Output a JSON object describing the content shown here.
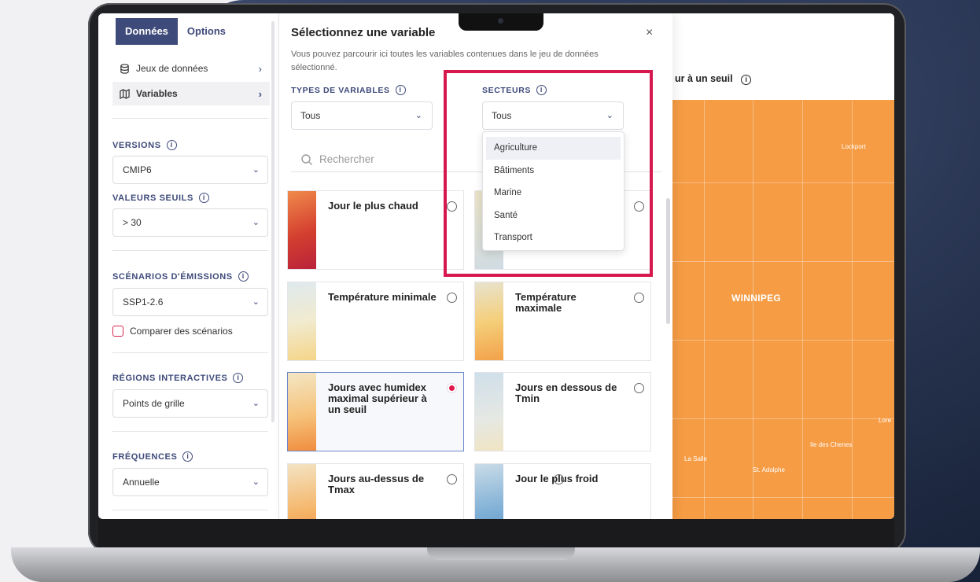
{
  "sidebar": {
    "tabs": [
      {
        "label": "Données"
      },
      {
        "label": "Options"
      }
    ],
    "nav": [
      {
        "label": "Jeux de données",
        "icon": "database-icon"
      },
      {
        "label": "Variables",
        "icon": "map-icon"
      }
    ],
    "versions": {
      "label": "VERSIONS",
      "value": "CMIP6"
    },
    "seuils": {
      "label": "VALEURS SEUILS",
      "value": "> 30"
    },
    "scenarios": {
      "label": "SCÉNARIOS D'ÉMISSIONS",
      "value": "SSP1-2.6",
      "compare_label": "Comparer des scénarios"
    },
    "regions": {
      "label": "RÉGIONS INTERACTIVES",
      "value": "Points de grille"
    },
    "frequences": {
      "label": "FRÉQUENCES",
      "value": "Annuelle"
    }
  },
  "modal": {
    "title": "Sélectionnez une variable",
    "close": "×",
    "description": "Vous pouvez parcourir ici toutes les variables contenues dans le jeu de données sélectionné.",
    "types": {
      "label": "TYPES DE VARIABLES",
      "value": "Tous"
    },
    "secteurs": {
      "label": "SECTEURS",
      "value": "Tous"
    },
    "search_placeholder": "Rechercher",
    "dropdown_options": [
      "Agriculture",
      "Bâtiments",
      "Marine",
      "Santé",
      "Transport"
    ],
    "cards": [
      {
        "title": "Jour le plus chaud",
        "selected": false
      },
      {
        "title": "",
        "selected": false
      },
      {
        "title": "Température minimale",
        "selected": false
      },
      {
        "title": "Température maximale",
        "selected": false
      },
      {
        "title": "Jours avec humidex maximal supérieur à un seuil",
        "selected": true
      },
      {
        "title": "Jours en dessous de Tmin",
        "selected": false
      },
      {
        "title": "Jours au-dessus de Tmax",
        "selected": false
      },
      {
        "title": "Jour le plus froid",
        "selected": false
      }
    ]
  },
  "map": {
    "title": "ur à un seuil",
    "city": "WINNIPEG",
    "labels": [
      "Lockport",
      "La Salle",
      "St. Adolphe",
      "Ile des Chenes",
      "Lore"
    ]
  },
  "colors": {
    "accent": "#3e4a7a",
    "highlight": "#d7184e",
    "map": "#f59c45"
  }
}
